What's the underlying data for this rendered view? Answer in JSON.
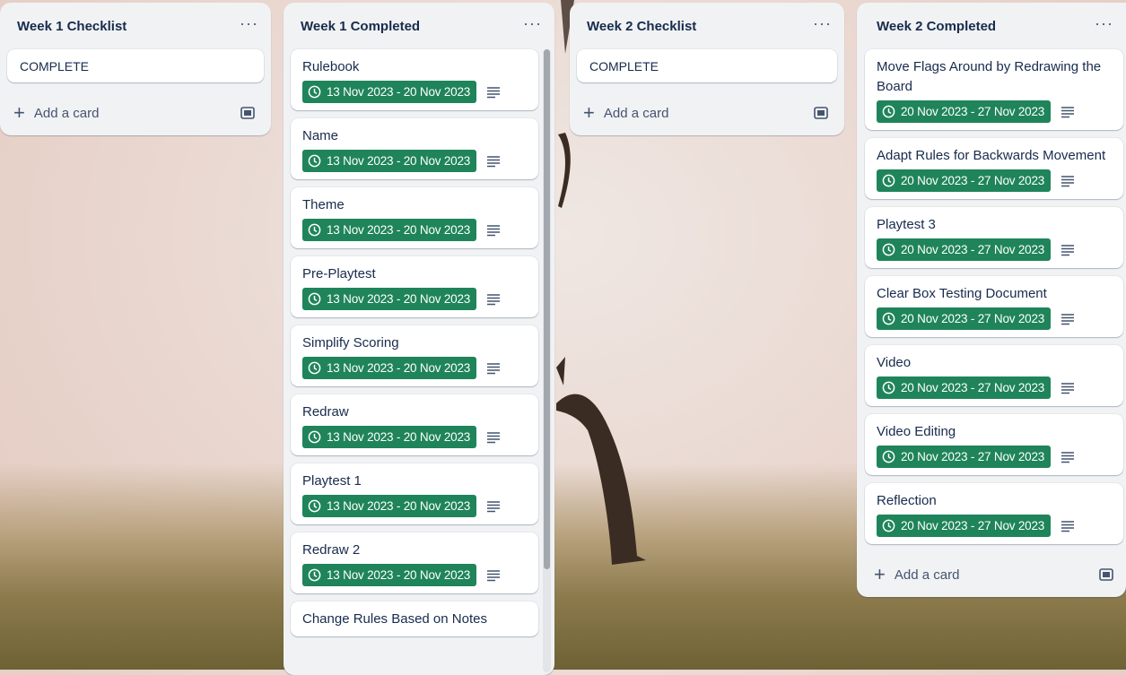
{
  "lists": [
    {
      "title": "Week 1 Checklist",
      "menu": "···",
      "cards": [
        "COMPLETE"
      ],
      "add_label": "Add a card"
    },
    {
      "title": "Week 1 Completed",
      "menu": "···",
      "cards": [
        {
          "title": "Rulebook",
          "date": "13 Nov 2023 - 20 Nov 2023"
        },
        {
          "title": "Name",
          "date": "13 Nov 2023 - 20 Nov 2023"
        },
        {
          "title": "Theme",
          "date": "13 Nov 2023 - 20 Nov 2023"
        },
        {
          "title": "Pre-Playtest",
          "date": "13 Nov 2023 - 20 Nov 2023"
        },
        {
          "title": "Simplify Scoring",
          "date": "13 Nov 2023 - 20 Nov 2023"
        },
        {
          "title": "Redraw",
          "date": "13 Nov 2023 - 20 Nov 2023"
        },
        {
          "title": "Playtest 1",
          "date": "13 Nov 2023 - 20 Nov 2023"
        },
        {
          "title": "Redraw 2",
          "date": "13 Nov 2023 - 20 Nov 2023"
        },
        {
          "title": "Change Rules Based on Notes",
          "date": ""
        }
      ]
    },
    {
      "title": "Week 2 Checklist",
      "menu": "···",
      "cards": [
        "COMPLETE"
      ],
      "add_label": "Add a card"
    },
    {
      "title": "Week 2 Completed",
      "menu": "···",
      "cards": [
        {
          "title": "Move Flags Around by Redrawing the Board",
          "date": "20 Nov 2023 - 27 Nov 2023"
        },
        {
          "title": "Adapt Rules for Backwards Movement",
          "date": "20 Nov 2023 - 27 Nov 2023"
        },
        {
          "title": "Playtest 3",
          "date": "20 Nov 2023 - 27 Nov 2023"
        },
        {
          "title": "Clear Box Testing Document",
          "date": "20 Nov 2023 - 27 Nov 2023"
        },
        {
          "title": "Video",
          "date": "20 Nov 2023 - 27 Nov 2023"
        },
        {
          "title": "Video Editing",
          "date": "20 Nov 2023 - 27 Nov 2023"
        },
        {
          "title": "Reflection",
          "date": "20 Nov 2023 - 27 Nov 2023"
        }
      ],
      "add_label": "Add a card"
    }
  ],
  "icons": {
    "clock": "clock-icon",
    "description": "description-icon",
    "plus": "plus-icon",
    "template": "card-template-icon",
    "menu": "more-icon"
  },
  "colors": {
    "date_badge": "#1f845a",
    "list_bg": "#f1f2f4",
    "text": "#172b4d"
  }
}
